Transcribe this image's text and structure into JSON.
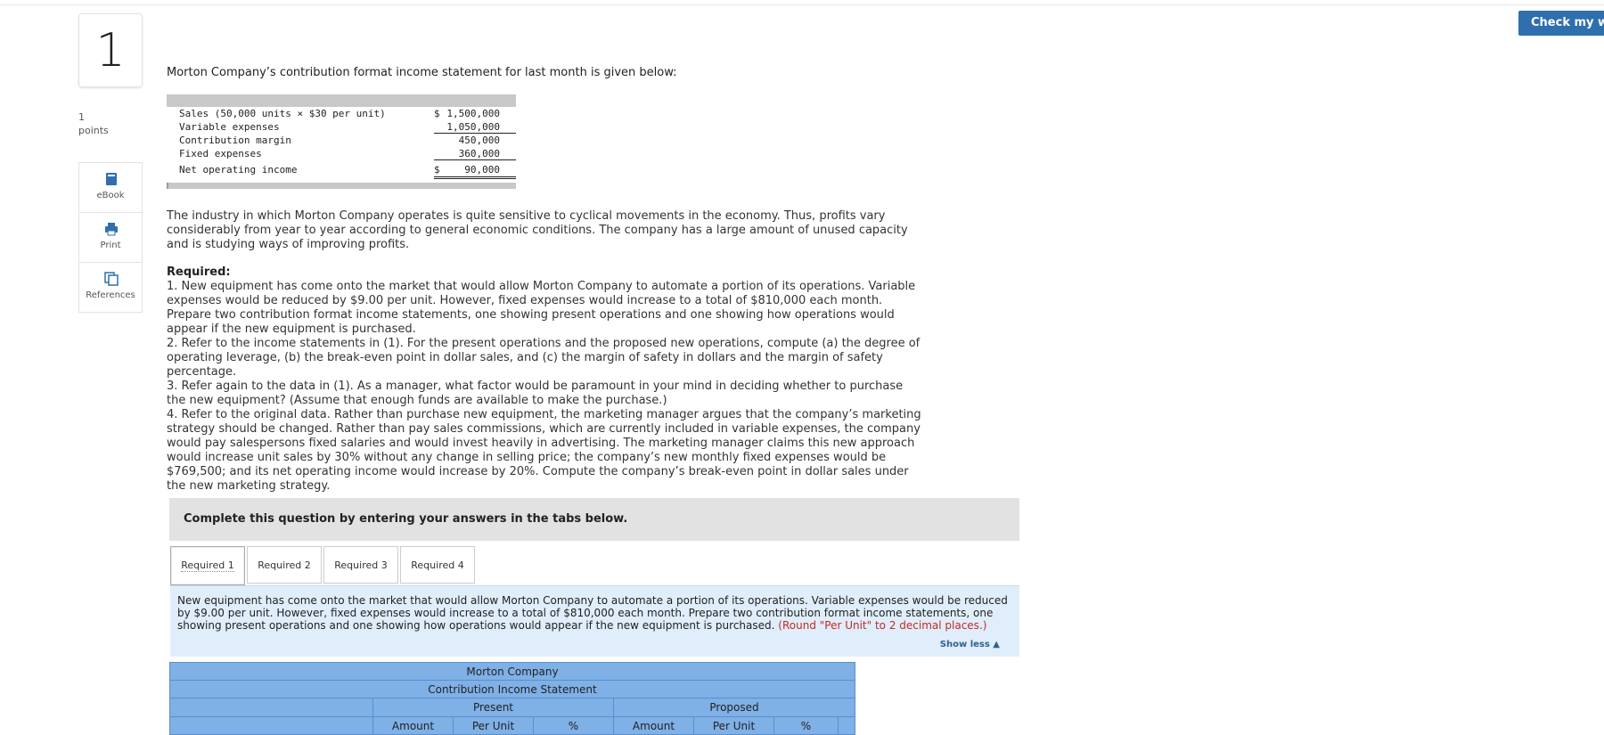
{
  "toolbar": {
    "check_label": "Check my wor"
  },
  "question": {
    "number": "1",
    "points_value": "1",
    "points_label": "points"
  },
  "tools": {
    "ebook": "eBook",
    "print": "Print",
    "references": "References"
  },
  "intro": "Morton Company’s contribution format income statement for last month is given below:",
  "statement": {
    "rows": [
      {
        "label": "Sales (50,000 units × $30 per unit)",
        "dollar": "$",
        "amount": "1,500,000"
      },
      {
        "label": "Variable expenses",
        "dollar": "",
        "amount": "1,050,000"
      },
      {
        "label": "Contribution margin",
        "dollar": "",
        "amount": "450,000"
      },
      {
        "label": "Fixed expenses",
        "dollar": "",
        "amount": "360,000"
      },
      {
        "label": "Net operating income",
        "dollar": "$",
        "amount": "90,000"
      }
    ]
  },
  "paragraph1": "The industry in which Morton Company operates is quite sensitive to cyclical movements in the economy. Thus, profits vary considerably from year to year according to general economic conditions. The company has a large amount of unused capacity and is studying ways of improving profits.",
  "required": {
    "title": "Required:",
    "items": [
      "1. New equipment has come onto the market that would allow Morton Company to automate a portion of its operations. Variable expenses would be reduced by $9.00 per unit. However, fixed expenses would increase to a total of $810,000 each month. Prepare two contribution format income statements, one showing present operations and one showing how operations would appear if the new equipment is purchased.",
      "2. Refer to the income statements in (1). For the present operations and the proposed new operations, compute (a) the degree of operating leverage, (b) the break-even point in dollar sales, and (c) the margin of safety in dollars and the margin of safety percentage.",
      "3. Refer again to the data in (1). As a manager, what factor would be paramount in your mind in deciding whether to purchase the new equipment? (Assume that enough funds are available to make the purchase.)",
      "4. Refer to the original data. Rather than purchase new equipment, the marketing manager argues that the company’s marketing strategy should be changed. Rather than pay sales commissions, which are currently included in variable expenses, the company would pay salespersons fixed salaries and would invest heavily in advertising. The marketing manager claims this new approach would increase unit sales by 30% without any change in selling price; the company’s new monthly fixed expenses would be $769,500; and its net operating income would increase by 20%. Compute the company’s break-even point in dollar sales under the new marketing strategy."
    ]
  },
  "complete_text": "Complete this question by entering your answers in the tabs below.",
  "tabs": [
    {
      "label": "Required 1",
      "active": true
    },
    {
      "label": "Required 2",
      "active": false
    },
    {
      "label": "Required 3",
      "active": false
    },
    {
      "label": "Required 4",
      "active": false
    }
  ],
  "panel": {
    "text": "New equipment has come onto the market that would allow Morton Company to automate a portion of its operations. Variable expenses would be reduced by $9.00 per unit. However, fixed expenses would increase to a total of $810,000 each month. Prepare two contribution format income statements, one showing present operations and one showing how operations would appear if the new equipment is purchased.",
    "hint": "(Round \"Per Unit\" to 2 decimal places.)",
    "show_less": "Show less ▲"
  },
  "answer_table": {
    "company": "Morton Company",
    "title": "Contribution Income Statement",
    "groups": [
      "Present",
      "Proposed"
    ],
    "columns": [
      "Amount",
      "Per Unit",
      "%",
      "Amount",
      "Per Unit",
      "%"
    ]
  }
}
